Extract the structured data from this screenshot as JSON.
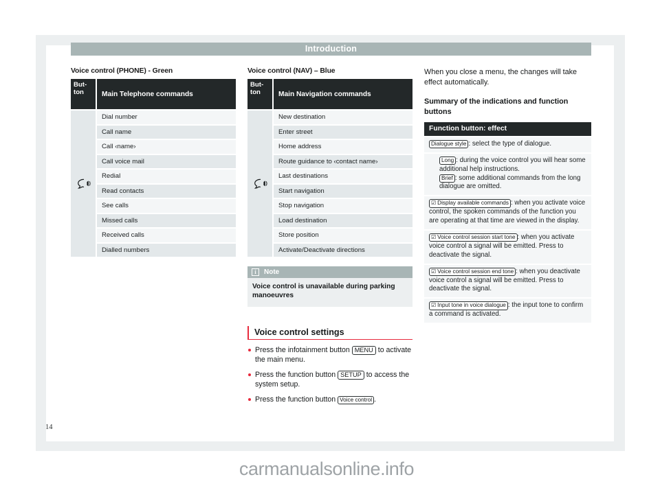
{
  "header": {
    "chapter_title": "Introduction"
  },
  "folio": {
    "page_number": "14"
  },
  "watermark": {
    "text": "carmanualsonline.info"
  },
  "colors": {
    "header_band": "#a8b5b5",
    "table_header": "#232829",
    "row_light": "#f4f6f7",
    "row_dark": "#e3e8ea",
    "accent_red": "#e8293c",
    "note_band": "#a8b5b5",
    "page_backplate": "#eceff0"
  },
  "left_column": {
    "caption": "Voice control (PHONE) - Green",
    "table": {
      "button_header": "But-\nton",
      "button_icon": "voice-control-icon",
      "commands_header": "Main Telephone commands",
      "rows": [
        "Dial number",
        "Call name",
        "Call ‹name›",
        "Call voice mail",
        "Redial",
        "Read contacts",
        "See calls",
        "Missed calls",
        "Received calls",
        "Dialled numbers"
      ]
    }
  },
  "middle_column": {
    "caption": "Voice control (NAV) – Blue",
    "table": {
      "button_header": "But-\nton",
      "button_icon": "voice-control-icon",
      "commands_header": "Main Navigation commands",
      "rows": [
        "New destination",
        "Enter street",
        "Home address",
        "Route guidance to ‹contact name›",
        "Last destinations",
        "Start navigation",
        "Stop navigation",
        "Load destination",
        "Store position",
        "Activate/Deactivate directions"
      ]
    },
    "note": {
      "icon": "info-icon",
      "title": "Note",
      "body": "Voice control is unavailable during parking manoeuvres"
    },
    "settings_section": {
      "heading": "Voice control settings",
      "bullets": [
        {
          "text_before": "Press the infotainment button ",
          "key": "MENU",
          "text_after": " to activate the main menu."
        },
        {
          "text_before": "Press the function button ",
          "key": "SETUP",
          "text_after": " to access the system setup."
        },
        {
          "text_before": "Press the function button ",
          "key": "Voice control",
          "text_after": "."
        }
      ]
    }
  },
  "right_column": {
    "intro_paragraph": "When you close a menu, the changes will take effect automatically.",
    "subheading": "Summary of the indications and function buttons",
    "table": {
      "header": "Function button: effect",
      "rows": [
        {
          "indent": false,
          "key": "Dialogue style",
          "checkbox": false,
          "text": ": select the type of dialogue."
        },
        {
          "indent": true,
          "sub_entries": [
            {
              "key": "Long",
              "text": ": during the voice control you will hear some additional help instructions."
            },
            {
              "key": "Brief",
              "text": ": some additional commands from the long dialogue are omitted."
            }
          ]
        },
        {
          "indent": false,
          "key": "Display available commands",
          "checkbox": true,
          "text": ": when you activate voice control, the spoken commands of the function you are operating at that time are viewed in the display."
        },
        {
          "indent": false,
          "key": "Voice control session start tone",
          "checkbox": true,
          "text": ": when you activate voice control a signal will be emitted. Press to deactivate the signal."
        },
        {
          "indent": false,
          "key": "Voice control session end tone",
          "checkbox": true,
          "text": ": when you deactivate voice control a signal will be emitted. Press to deactivate the signal."
        },
        {
          "indent": false,
          "key": "Input tone in voice dialogue",
          "checkbox": true,
          "text": ": the input tone to confirm a command is activated."
        }
      ]
    }
  }
}
